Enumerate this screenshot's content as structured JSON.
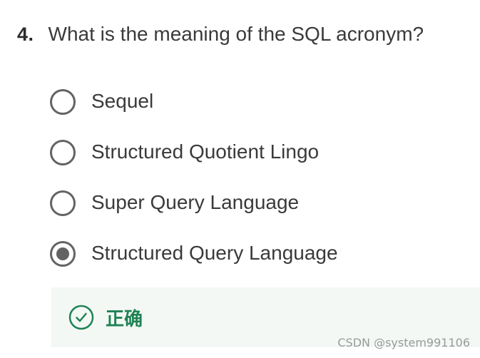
{
  "question": {
    "number": "4.",
    "text": "What is the meaning of the SQL acronym?"
  },
  "options": [
    {
      "label": "Sequel",
      "selected": false
    },
    {
      "label": "Structured Quotient Lingo",
      "selected": false
    },
    {
      "label": "Super Query Language",
      "selected": false
    },
    {
      "label": "Structured Query Language",
      "selected": true
    }
  ],
  "feedback": {
    "icon": "check-circle-icon",
    "label": "正确",
    "color": "#1f8354"
  },
  "watermark": "CSDN @system991106"
}
